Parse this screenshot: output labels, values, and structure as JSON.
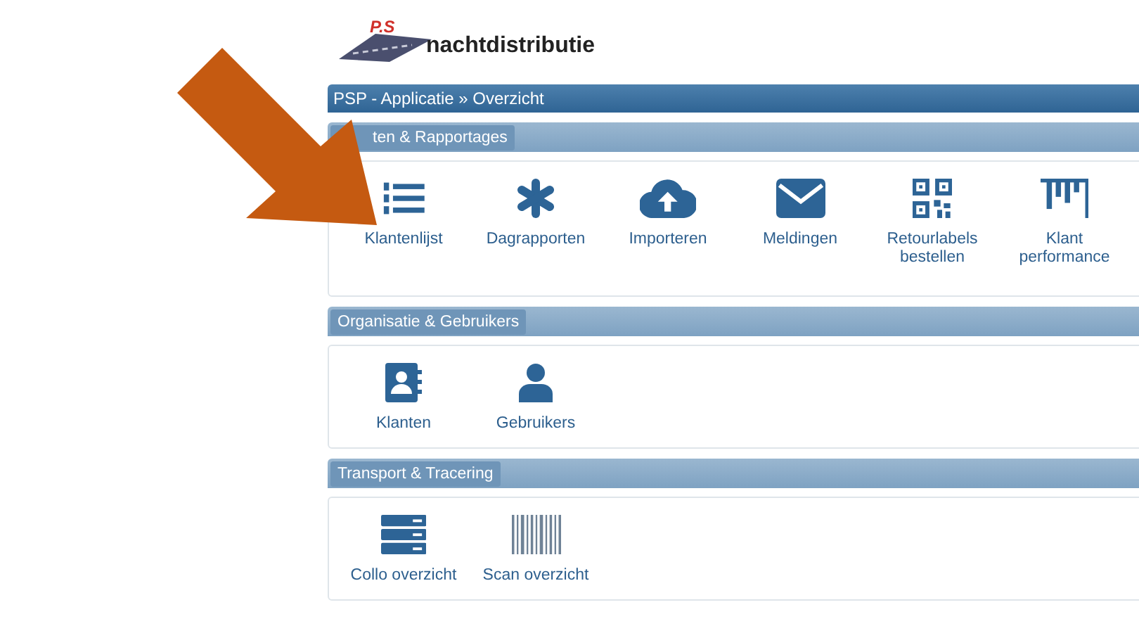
{
  "logo": {
    "badge": "P.S",
    "name": "nachtdistributie"
  },
  "breadcrumb": "PSP - Applicatie » Overzicht",
  "sections": [
    {
      "title": "ten & Rapportages",
      "tiles": [
        {
          "kind": "list",
          "label": "Klantenlijst"
        },
        {
          "kind": "asterisk",
          "label": "Dagrapporten"
        },
        {
          "kind": "cloud",
          "label": "Importeren"
        },
        {
          "kind": "envelope",
          "label": "Meldingen"
        },
        {
          "kind": "qr",
          "label": "Retourlabels bestellen"
        },
        {
          "kind": "chart",
          "label": "Klant performance"
        }
      ]
    },
    {
      "title": "Organisatie & Gebruikers",
      "tiles": [
        {
          "kind": "contacts",
          "label": "Klanten"
        },
        {
          "kind": "user",
          "label": "Gebruikers"
        }
      ]
    },
    {
      "title": "Transport & Tracering",
      "tiles": [
        {
          "kind": "server",
          "label": "Collo overzicht"
        },
        {
          "kind": "barcode",
          "label": "Scan overzicht"
        }
      ]
    }
  ]
}
